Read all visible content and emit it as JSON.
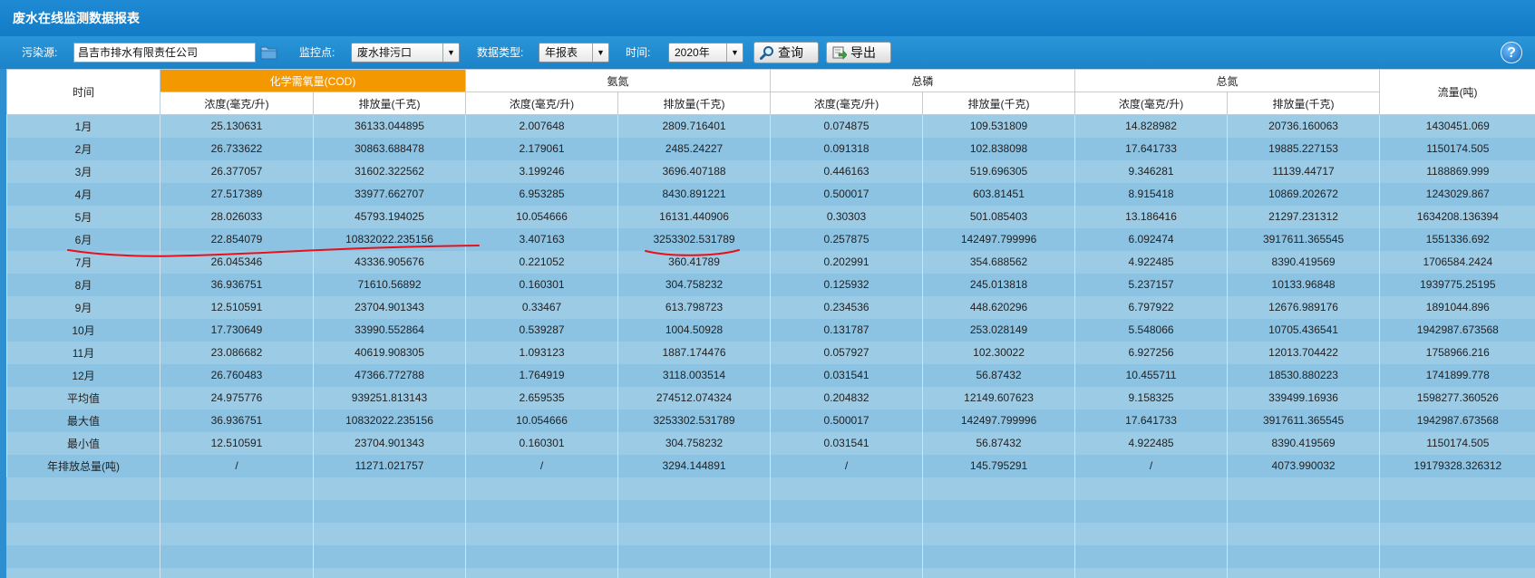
{
  "window": {
    "title": "废水在线监测数据报表"
  },
  "toolbar": {
    "pollution_source_label": "污染源:",
    "pollution_source_value": "昌吉市排水有限责任公司",
    "monitor_point_label": "监控点:",
    "monitor_point_value": "废水排污口",
    "data_type_label": "数据类型:",
    "data_type_value": "年报表",
    "time_label": "时间:",
    "time_value": "2020年",
    "query_label": "查询",
    "export_label": "导出",
    "help_glyph": "?"
  },
  "table": {
    "time_header": "时间",
    "groups": [
      "化学需氧量(COD)",
      "氨氮",
      "总磷",
      "总氮"
    ],
    "flow_header": "流量(吨)",
    "sub_headers": [
      "浓度(毫克/升)",
      "排放量(千克)"
    ],
    "rows": [
      [
        "1月",
        "25.130631",
        "36133.044895",
        "2.007648",
        "2809.716401",
        "0.074875",
        "109.531809",
        "14.828982",
        "20736.160063",
        "1430451.069"
      ],
      [
        "2月",
        "26.733622",
        "30863.688478",
        "2.179061",
        "2485.24227",
        "0.091318",
        "102.838098",
        "17.641733",
        "19885.227153",
        "1150174.505"
      ],
      [
        "3月",
        "26.377057",
        "31602.322562",
        "3.199246",
        "3696.407188",
        "0.446163",
        "519.696305",
        "9.346281",
        "11139.44717",
        "1188869.999"
      ],
      [
        "4月",
        "27.517389",
        "33977.662707",
        "6.953285",
        "8430.891221",
        "0.500017",
        "603.81451",
        "8.915418",
        "10869.202672",
        "1243029.867"
      ],
      [
        "5月",
        "28.026033",
        "45793.194025",
        "10.054666",
        "16131.440906",
        "0.30303",
        "501.085403",
        "13.186416",
        "21297.231312",
        "1634208.136394"
      ],
      [
        "6月",
        "22.854079",
        "10832022.235156",
        "3.407163",
        "3253302.531789",
        "0.257875",
        "142497.799996",
        "6.092474",
        "3917611.365545",
        "1551336.692"
      ],
      [
        "7月",
        "26.045346",
        "43336.905676",
        "0.221052",
        "360.41789",
        "0.202991",
        "354.688562",
        "4.922485",
        "8390.419569",
        "1706584.2424"
      ],
      [
        "8月",
        "36.936751",
        "71610.56892",
        "0.160301",
        "304.758232",
        "0.125932",
        "245.013818",
        "5.237157",
        "10133.96848",
        "1939775.25195"
      ],
      [
        "9月",
        "12.510591",
        "23704.901343",
        "0.33467",
        "613.798723",
        "0.234536",
        "448.620296",
        "6.797922",
        "12676.989176",
        "1891044.896"
      ],
      [
        "10月",
        "17.730649",
        "33990.552864",
        "0.539287",
        "1004.50928",
        "0.131787",
        "253.028149",
        "5.548066",
        "10705.436541",
        "1942987.673568"
      ],
      [
        "11月",
        "23.086682",
        "40619.908305",
        "1.093123",
        "1887.174476",
        "0.057927",
        "102.30022",
        "6.927256",
        "12013.704422",
        "1758966.216"
      ],
      [
        "12月",
        "26.760483",
        "47366.772788",
        "1.764919",
        "3118.003514",
        "0.031541",
        "56.87432",
        "10.455711",
        "18530.880223",
        "1741899.778"
      ],
      [
        "平均值",
        "24.975776",
        "939251.813143",
        "2.659535",
        "274512.074324",
        "0.204832",
        "12149.607623",
        "9.158325",
        "339499.16936",
        "1598277.360526"
      ],
      [
        "最大值",
        "36.936751",
        "10832022.235156",
        "10.054666",
        "3253302.531789",
        "0.500017",
        "142497.799996",
        "17.641733",
        "3917611.365545",
        "1942987.673568"
      ],
      [
        "最小值",
        "12.510591",
        "23704.901343",
        "0.160301",
        "304.758232",
        "0.031541",
        "56.87432",
        "4.922485",
        "8390.419569",
        "1150174.505"
      ],
      [
        "年排放总量(吨)",
        "/",
        "11271.021757",
        "/",
        "3294.144891",
        "/",
        "145.795291",
        "/",
        "4073.990032",
        "19179328.326312"
      ]
    ]
  },
  "colors": {
    "highlight_header": "#f39800",
    "annotation_pen": "#e8101a"
  }
}
